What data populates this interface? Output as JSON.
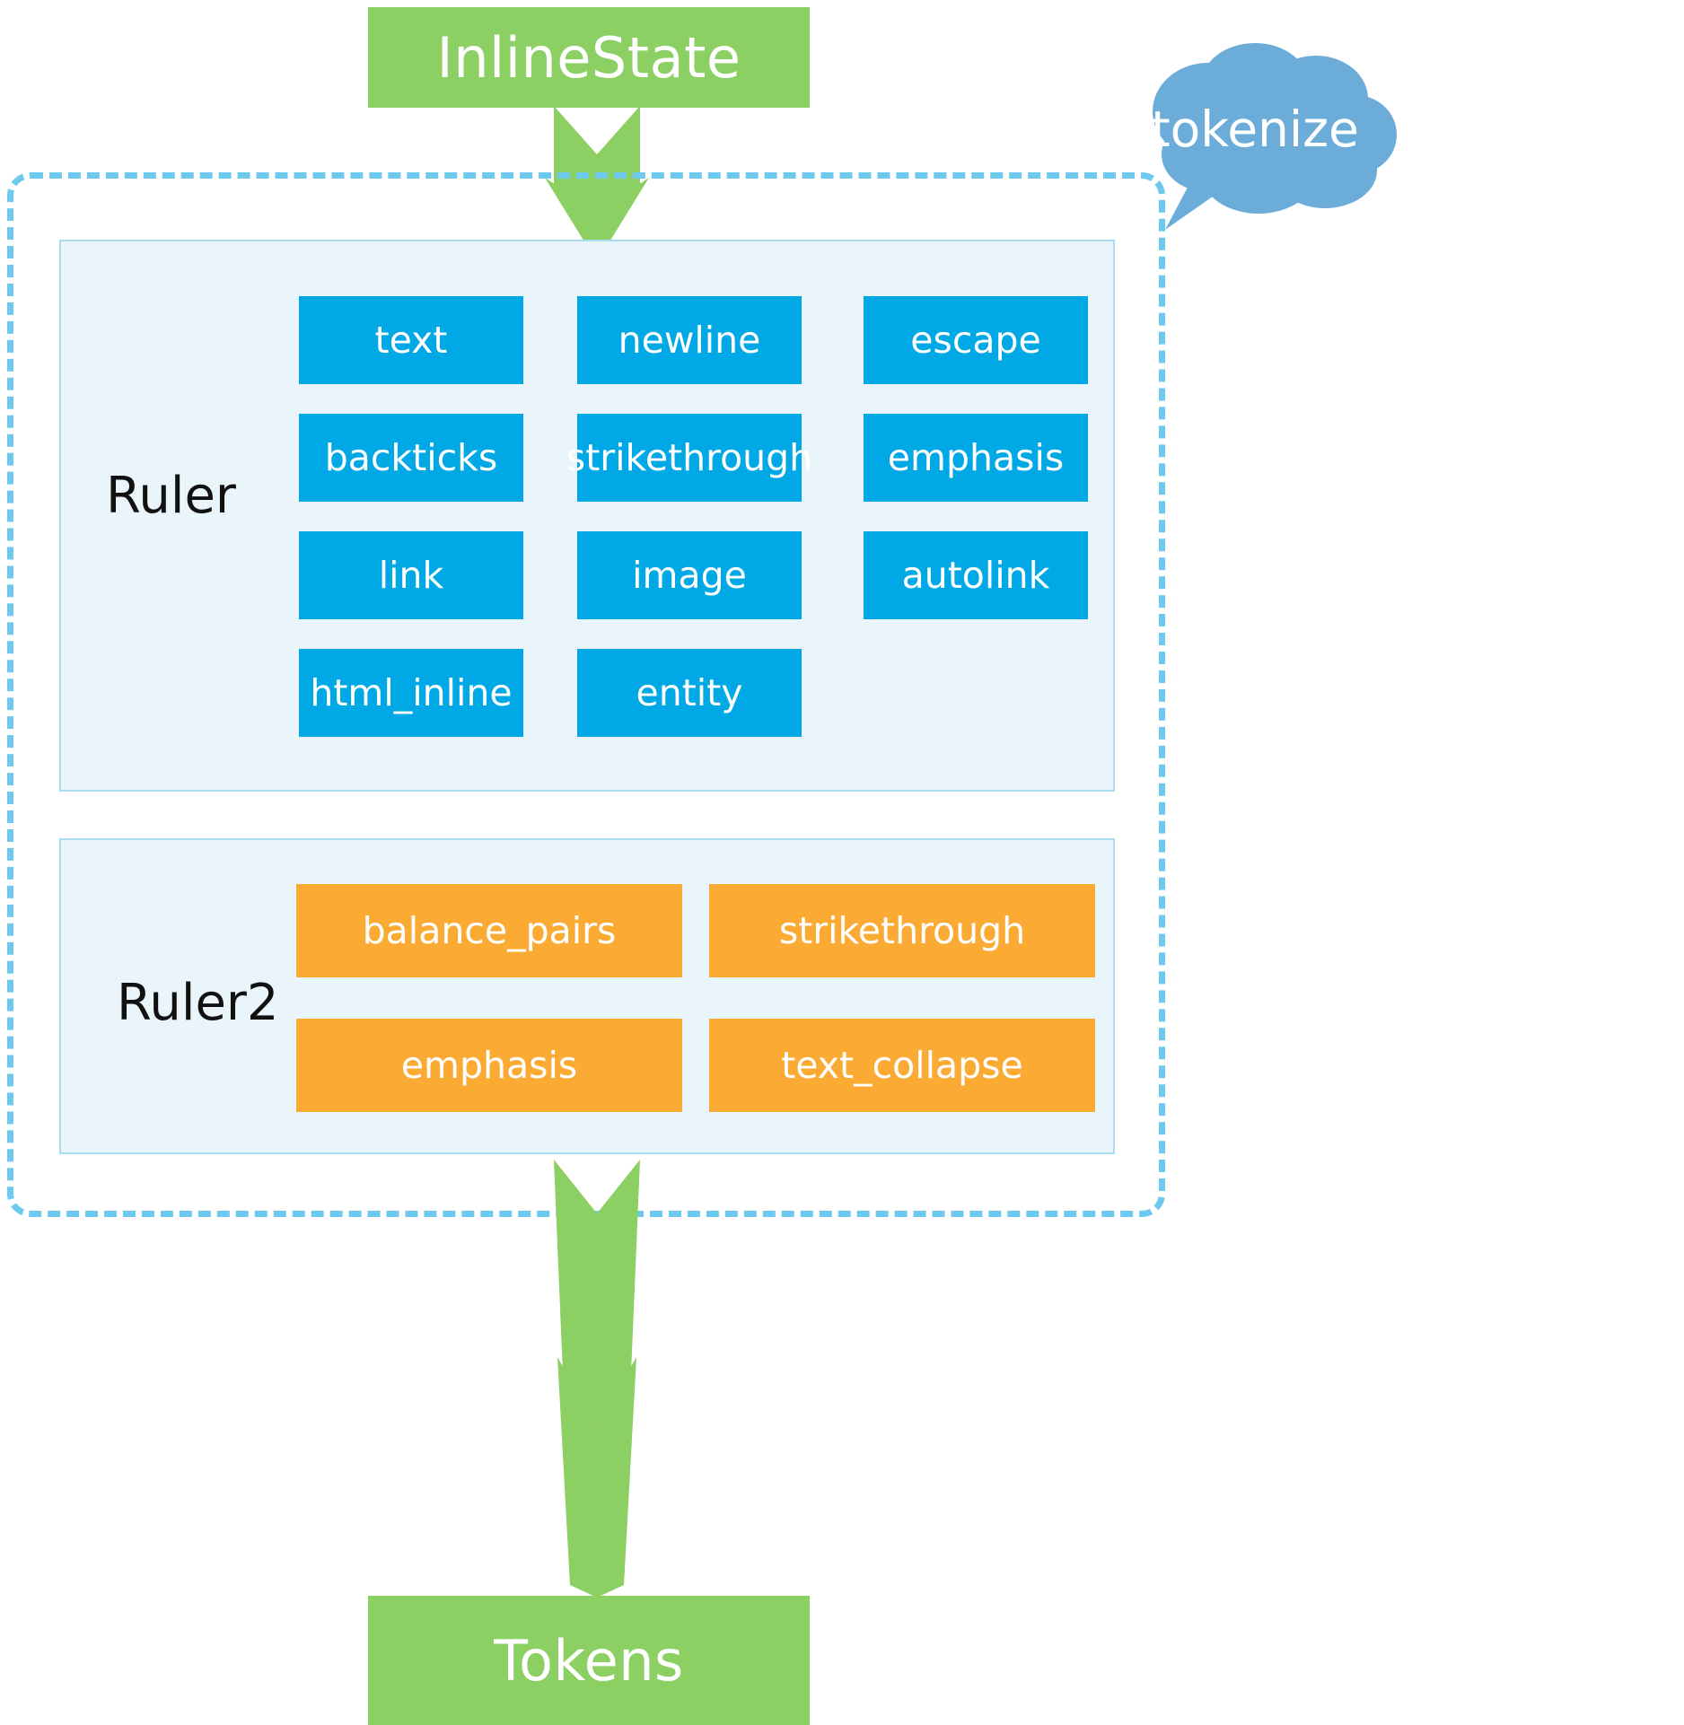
{
  "colors": {
    "green": "#8ccf63",
    "blue_chip": "#00a9e6",
    "orange_chip": "#fbab34",
    "panel_bg": "#e9f5fb",
    "panel_border": "#aadcf0",
    "dashed_border": "#6ec9ee",
    "cloud": "#6cacd9",
    "text_dark": "#111111",
    "text_light": "#ffffff"
  },
  "input": {
    "label": "InlineState"
  },
  "output": {
    "label": "Tokens"
  },
  "annotation": {
    "label": "tokenize",
    "icon": "speech-cloud-icon"
  },
  "ruler": {
    "label": "Ruler",
    "rules": [
      {
        "label": "text",
        "col": 0,
        "row": 0
      },
      {
        "label": "newline",
        "col": 1,
        "row": 0
      },
      {
        "label": "escape",
        "col": 2,
        "row": 0
      },
      {
        "label": "backticks",
        "col": 0,
        "row": 1
      },
      {
        "label": "strikethrough",
        "col": 1,
        "row": 1
      },
      {
        "label": "emphasis",
        "col": 2,
        "row": 1
      },
      {
        "label": "link",
        "col": 0,
        "row": 2
      },
      {
        "label": "image",
        "col": 1,
        "row": 2
      },
      {
        "label": "autolink",
        "col": 2,
        "row": 2
      },
      {
        "label": "html_inline",
        "col": 0,
        "row": 3
      },
      {
        "label": "entity",
        "col": 1,
        "row": 3
      }
    ]
  },
  "ruler2": {
    "label": "Ruler2",
    "rules": [
      {
        "label": "balance_pairs",
        "col": 0,
        "row": 0
      },
      {
        "label": "strikethrough",
        "col": 1,
        "row": 0
      },
      {
        "label": "emphasis",
        "col": 0,
        "row": 1
      },
      {
        "label": "text_collapse",
        "col": 1,
        "row": 1
      }
    ]
  },
  "arrows": {
    "top": "arrow-down-icon",
    "bottom": "arrow-down-icon"
  }
}
